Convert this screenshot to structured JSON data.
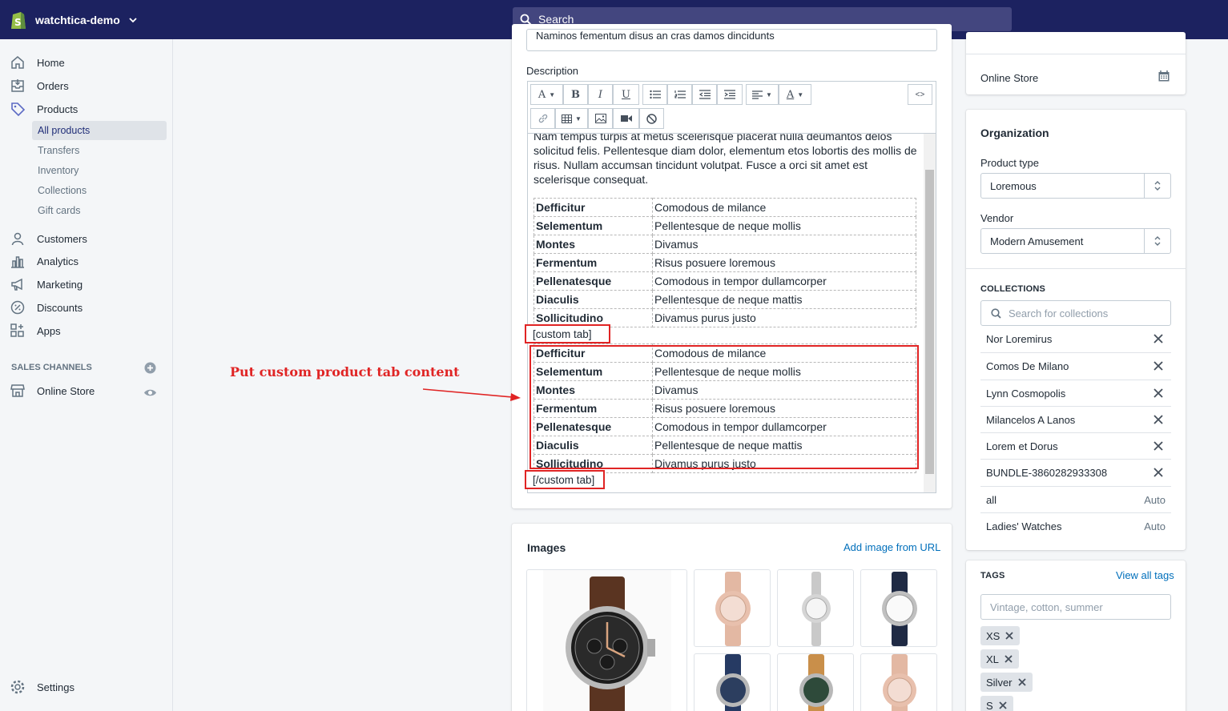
{
  "topbar": {
    "store_name": "watchtica-demo",
    "search_placeholder": "Search"
  },
  "sidebar": {
    "nav": [
      {
        "label": "Home",
        "icon": "home-icon"
      },
      {
        "label": "Orders",
        "icon": "orders-icon"
      },
      {
        "label": "Products",
        "icon": "tag-icon"
      },
      {
        "label": "Customers",
        "icon": "person-icon"
      },
      {
        "label": "Analytics",
        "icon": "bar-chart-icon"
      },
      {
        "label": "Marketing",
        "icon": "megaphone-icon"
      },
      {
        "label": "Discounts",
        "icon": "discount-icon"
      },
      {
        "label": "Apps",
        "icon": "apps-icon"
      }
    ],
    "product_sub": [
      "All products",
      "Transfers",
      "Inventory",
      "Collections",
      "Gift cards"
    ],
    "sales_channels_heading": "SALES CHANNELS",
    "online_store": "Online Store",
    "settings": "Settings"
  },
  "product": {
    "title_value": "Naminos fementum disus an cras damos dincidunts",
    "description_label": "Description",
    "description_text": "Nam tempus turpis at metus scelerisque placerat nulla deumantos delos solicitud felis. Pellentesque diam dolor, elementum etos lobortis des mollis de risus. Nullam accumsan tincidunt volutpat. Fusce a orci sit amet est scelerisque consequat.",
    "spec_table": [
      [
        "Defficitur",
        "Comodous de milance"
      ],
      [
        "Selementum",
        "Pellentesque de neque mollis"
      ],
      [
        "Montes",
        "Divamus"
      ],
      [
        "Fermentum",
        "Risus posuere loremous"
      ],
      [
        "Pellenatesque",
        "Comodous in tempor dullamcorper"
      ],
      [
        "Diaculis",
        "Pellentesque de neque mattis"
      ],
      [
        "Sollicitudino",
        "Divamus purus justo"
      ]
    ],
    "custom_tab_open": "[custom tab]",
    "custom_tab_close": "[/custom tab]",
    "annotation": "Put custom product tab content",
    "toolbar_glyphs": {
      "font": "A",
      "bold": "B",
      "italic": "I",
      "underline": "U",
      "color": "A",
      "html": "<>"
    }
  },
  "images": {
    "heading": "Images",
    "add_from_url": "Add image from URL"
  },
  "right": {
    "online_store_label": "Online Store",
    "organization_heading": "Organization",
    "product_type_label": "Product type",
    "product_type_value": "Loremous",
    "vendor_label": "Vendor",
    "vendor_value": "Modern Amusement",
    "collections_heading": "COLLECTIONS",
    "collections_placeholder": "Search for collections",
    "collections": [
      {
        "name": "Nor Loremirus",
        "status": ""
      },
      {
        "name": "Comos De Milano",
        "status": ""
      },
      {
        "name": "Lynn Cosmopolis",
        "status": ""
      },
      {
        "name": "Milancelos A Lanos",
        "status": ""
      },
      {
        "name": "Lorem et Dorus",
        "status": ""
      },
      {
        "name": "BUNDLE-3860282933308",
        "status": ""
      },
      {
        "name": "all",
        "status": "Auto"
      },
      {
        "name": "Ladies' Watches",
        "status": "Auto"
      }
    ],
    "tags_heading": "TAGS",
    "view_all_tags": "View all tags",
    "tags_placeholder": "Vintage, cotton, summer",
    "tags": [
      "XS",
      "XL",
      "Silver",
      "S"
    ]
  },
  "colors": {
    "topbar": "#1c2260",
    "search_bg": "#43467f",
    "accent_link": "#006fbb",
    "annotation_red": "#e02424",
    "active_nav_text": "#202e78"
  }
}
